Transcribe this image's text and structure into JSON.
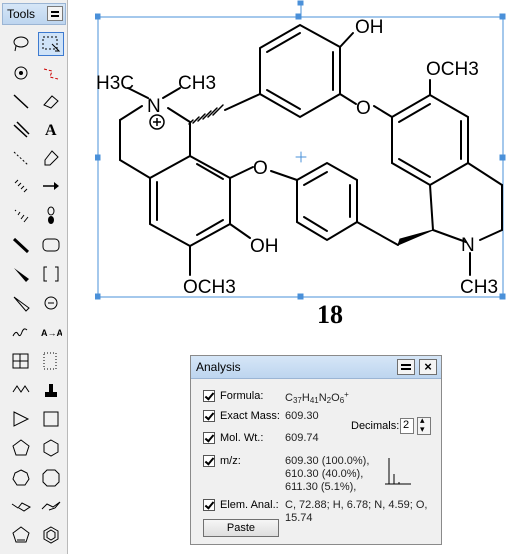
{
  "tools": {
    "title": "Tools",
    "items": [
      {
        "name": "lasso-tool-icon"
      },
      {
        "name": "marquee-tool-icon",
        "selected": true
      },
      {
        "name": "rotate-tool-icon"
      },
      {
        "name": "eraser-bond-tool-icon"
      },
      {
        "name": "solid-bond-tool-icon"
      },
      {
        "name": "eraser-tool-icon"
      },
      {
        "name": "double-bond-tool-icon"
      },
      {
        "name": "text-tool-icon"
      },
      {
        "name": "dashed-bond-tool-icon"
      },
      {
        "name": "pen-tool-icon"
      },
      {
        "name": "hashed-bond-tool-icon"
      },
      {
        "name": "arrow-tool-icon"
      },
      {
        "name": "hashed-wedge-tool-icon"
      },
      {
        "name": "orbital-tool-icon"
      },
      {
        "name": "bold-bond-tool-icon"
      },
      {
        "name": "rounded-rect-tool-icon"
      },
      {
        "name": "wedge-bond-tool-icon"
      },
      {
        "name": "bracket-tool-icon"
      },
      {
        "name": "hollow-wedge-tool-icon"
      },
      {
        "name": "charge-tool-icon"
      },
      {
        "name": "wavy-bond-tool-icon"
      },
      {
        "name": "atom-map-tool-icon",
        "label": "A→A"
      },
      {
        "name": "table-tool-icon"
      },
      {
        "name": "dotted-box-tool-icon"
      },
      {
        "name": "chain-tool-icon"
      },
      {
        "name": "template-tool-icon"
      },
      {
        "name": "triangle-ring-icon"
      },
      {
        "name": "square-ring-icon"
      },
      {
        "name": "pentagon-ring-icon"
      },
      {
        "name": "hexagon-ring-icon"
      },
      {
        "name": "heptagon-ring-icon"
      },
      {
        "name": "octagon-ring-icon"
      },
      {
        "name": "cyclohexane-chair-icon"
      },
      {
        "name": "cyclohexane-chair-2-icon"
      },
      {
        "name": "cyclopentadiene-icon"
      },
      {
        "name": "benzene-ring-icon"
      }
    ]
  },
  "molecule": {
    "labels": {
      "oh_top": "OH",
      "och3_right": "OCH3",
      "o_upper": "O",
      "h3c_left": "H3C",
      "ch3_left": "CH3",
      "n_plus": "N",
      "o_left": "O",
      "oh_bottom": "OH",
      "och3_bottom": "OCH3",
      "n_right": "N",
      "ch3_right": "CH3"
    },
    "compound_number": "18"
  },
  "analysis": {
    "title": "Analysis",
    "formula_label": "Formula:",
    "formula_value": "C37H41N2O6+",
    "exact_mass_label": "Exact Mass:",
    "exact_mass_value": "609.30",
    "mol_wt_label": "Mol. Wt.:",
    "mol_wt_value": "609.74",
    "decimals_label": "Decimals:",
    "decimals_value": "2",
    "mz_label": "m/z:",
    "mz_values": [
      "609.30 (100.0%),",
      "610.30 (40.0%),",
      "611.30 (5.1%),"
    ],
    "elem_anal_label": "Elem. Anal.:",
    "elem_anal_value_1": "C, 72.88; H, 6.78; N, 4.59; O,",
    "elem_anal_value_2": "15.74",
    "paste_label": "Paste"
  }
}
